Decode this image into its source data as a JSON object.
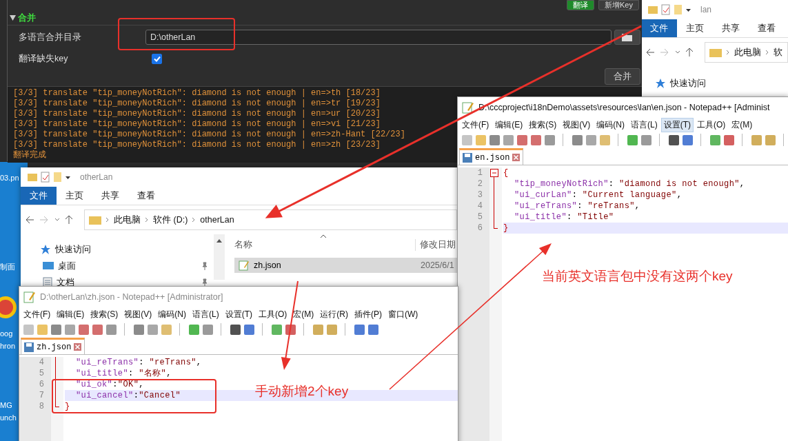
{
  "desktop": {
    "icon_labels": [
      "03.pn",
      "制面",
      "oog",
      "hron",
      "MG",
      "unch"
    ]
  },
  "tool_panel": {
    "top_buttons": [
      {
        "label": "翻译",
        "kind": "primary"
      },
      {
        "label": "新增Key",
        "kind": "default"
      }
    ],
    "section": {
      "title": "合并",
      "expanded": true
    },
    "merge_dir": {
      "label": "多语言合并目录",
      "value": "D:\\otherLan"
    },
    "translate_missing": {
      "label": "翻译缺失key",
      "checked": true
    },
    "merge_button": "合并",
    "log_lines": [
      "[3/3] translate \"tip_moneyNotRich\": diamond is not enough | en=>th [18/23]",
      "[3/3] translate \"tip_moneyNotRich\": diamond is not enough | en=>tr [19/23]",
      "[3/3] translate \"tip_moneyNotRich\": diamond is not enough | en=>ur [20/23]",
      "[3/3] translate \"tip_moneyNotRich\": diamond is not enough | en=>vi [21/23]",
      "[3/3] translate \"tip_moneyNotRich\": diamond is not enough | en=>zh-Hant [22/23]",
      "[3/3] translate \"tip_moneyNotRich\": diamond is not enough | en=>zh [23/23]",
      "翻译完成"
    ]
  },
  "explorer_lan": {
    "title": "lan",
    "ribbon_tabs": [
      {
        "label": "文件",
        "selected": true
      },
      {
        "label": "主页",
        "selected": false
      },
      {
        "label": "共享",
        "selected": false
      },
      {
        "label": "查看",
        "selected": false
      }
    ],
    "breadcrumb": [
      "此电脑",
      "软"
    ],
    "nav_items": [
      {
        "label": "快速访问",
        "kind": "quick"
      }
    ]
  },
  "explorer_other": {
    "title": "otherLan",
    "ribbon_tabs": [
      {
        "label": "文件",
        "selected": true
      },
      {
        "label": "主页",
        "selected": false
      },
      {
        "label": "共享",
        "selected": false
      },
      {
        "label": "查看",
        "selected": false
      }
    ],
    "breadcrumb": [
      "此电脑",
      "软件 (D:)",
      "otherLan"
    ],
    "nav_items": [
      {
        "label": "快速访问",
        "kind": "quick"
      },
      {
        "label": "桌面",
        "kind": "desktop"
      },
      {
        "label": "文档",
        "kind": "docs"
      }
    ],
    "columns": [
      "名称",
      "修改日期"
    ],
    "files": [
      {
        "name": "zh.json",
        "date": "2025/6/1",
        "selected": true
      }
    ]
  },
  "notepad_en": {
    "title": "D:\\cccproject\\i18nDemo\\assets\\resources\\lan\\en.json - Notepad++ [Administ",
    "active": true,
    "menu": [
      {
        "label": "文件(F)",
        "highlighted": false
      },
      {
        "label": "编辑(E)",
        "highlighted": false
      },
      {
        "label": "搜索(S)",
        "highlighted": false
      },
      {
        "label": "视图(V)",
        "highlighted": false
      },
      {
        "label": "编码(N)",
        "highlighted": false
      },
      {
        "label": "语言(L)",
        "highlighted": false
      },
      {
        "label": "设置(T)",
        "highlighted": true
      },
      {
        "label": "工具(O)",
        "highlighted": false
      },
      {
        "label": "宏(M)",
        "highlighted": false
      }
    ],
    "tab": "en.json",
    "lines": [
      {
        "num": "1",
        "current": false,
        "tokens": [
          {
            "kind": "brace",
            "text": "{"
          }
        ]
      },
      {
        "num": "2",
        "current": false,
        "tokens": [
          {
            "kind": "key",
            "text": "\"tip_moneyNotRich\""
          },
          {
            "kind": "punct",
            "text": ": "
          },
          {
            "kind": "string",
            "text": "\"diamond is not enough\""
          },
          {
            "kind": "punct",
            "text": ","
          }
        ]
      },
      {
        "num": "3",
        "current": false,
        "tokens": [
          {
            "kind": "key",
            "text": "\"ui_curLan\""
          },
          {
            "kind": "punct",
            "text": ": "
          },
          {
            "kind": "string",
            "text": "\"Current language\""
          },
          {
            "kind": "punct",
            "text": ","
          }
        ]
      },
      {
        "num": "4",
        "current": false,
        "tokens": [
          {
            "kind": "key",
            "text": "\"ui_reTrans\""
          },
          {
            "kind": "punct",
            "text": ": "
          },
          {
            "kind": "string",
            "text": "\"reTrans\""
          },
          {
            "kind": "punct",
            "text": ","
          }
        ]
      },
      {
        "num": "5",
        "current": false,
        "tokens": [
          {
            "kind": "key",
            "text": "\"ui_title\""
          },
          {
            "kind": "punct",
            "text": ": "
          },
          {
            "kind": "string",
            "text": "\"Title\""
          }
        ]
      },
      {
        "num": "6",
        "current": true,
        "tokens": [
          {
            "kind": "brace",
            "text": "}"
          }
        ]
      }
    ]
  },
  "notepad_zh": {
    "title": "D:\\otherLan\\zh.json - Notepad++ [Administrator]",
    "active": false,
    "menu": [
      {
        "label": "文件(F)",
        "highlighted": false
      },
      {
        "label": "编辑(E)",
        "highlighted": false
      },
      {
        "label": "搜索(S)",
        "highlighted": false
      },
      {
        "label": "视图(V)",
        "highlighted": false
      },
      {
        "label": "编码(N)",
        "highlighted": false
      },
      {
        "label": "语言(L)",
        "highlighted": false
      },
      {
        "label": "设置(T)",
        "highlighted": false
      },
      {
        "label": "工具(O)",
        "highlighted": false
      },
      {
        "label": "宏(M)",
        "highlighted": false
      },
      {
        "label": "运行(R)",
        "highlighted": false
      },
      {
        "label": "插件(P)",
        "highlighted": false
      },
      {
        "label": "窗口(W)",
        "highlighted": false
      }
    ],
    "tab": "zh.json",
    "lines": [
      {
        "num": "4",
        "current": false,
        "tokens": [
          {
            "kind": "key",
            "text": "\"ui_reTrans\""
          },
          {
            "kind": "punct",
            "text": ": "
          },
          {
            "kind": "string",
            "text": "\"reTrans\""
          },
          {
            "kind": "punct",
            "text": ","
          }
        ]
      },
      {
        "num": "5",
        "current": false,
        "tokens": [
          {
            "kind": "key",
            "text": "\"ui_title\""
          },
          {
            "kind": "punct",
            "text": ": "
          },
          {
            "kind": "string",
            "text": "\"名称\""
          },
          {
            "kind": "punct",
            "text": ","
          }
        ]
      },
      {
        "num": "6",
        "current": false,
        "tokens": [
          {
            "kind": "key",
            "text": "\"ui_ok\""
          },
          {
            "kind": "punct",
            "text": ":"
          },
          {
            "kind": "string",
            "text": "\"OK\""
          },
          {
            "kind": "punct",
            "text": ","
          }
        ]
      },
      {
        "num": "7",
        "current": true,
        "tokens": [
          {
            "kind": "key",
            "text": "\"ui_cancel\""
          },
          {
            "kind": "punct",
            "text": ":"
          },
          {
            "kind": "string",
            "text": "\"Cancel\""
          }
        ]
      },
      {
        "num": "8",
        "current": false,
        "tokens": [
          {
            "kind": "brace",
            "text": "}"
          }
        ]
      }
    ]
  },
  "annotations": [
    {
      "text": "当前英文语言包中没有这两个key"
    },
    {
      "text": "手动新增2个key"
    }
  ]
}
